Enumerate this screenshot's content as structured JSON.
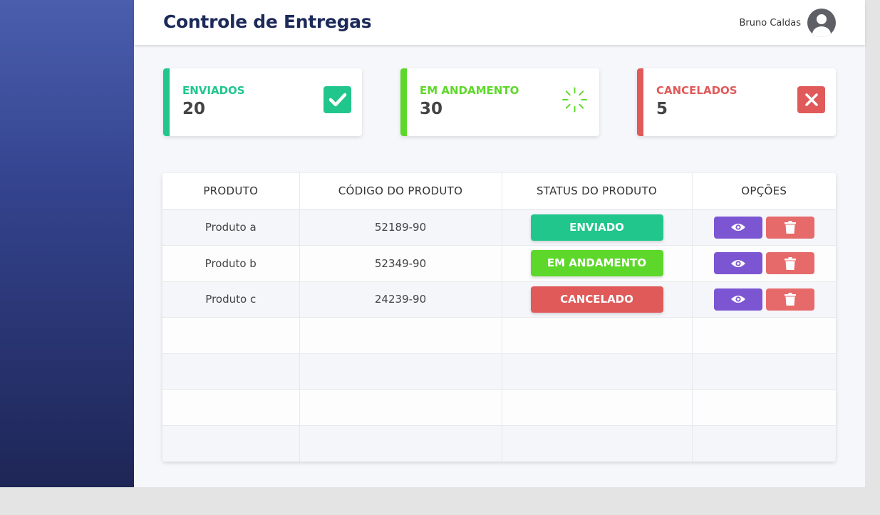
{
  "header": {
    "title": "Controle de Entregas",
    "user_name": "Bruno Caldas"
  },
  "cards": [
    {
      "label": "ENVIADOS",
      "value": "20",
      "icon": "check-icon",
      "color": "#21c68d"
    },
    {
      "label": "EM ANDAMENTO",
      "value": "30",
      "icon": "spinner-icon",
      "color": "#5dd82a"
    },
    {
      "label": "CANCELADOS",
      "value": "5",
      "icon": "x-icon",
      "color": "#e05a5a"
    }
  ],
  "table": {
    "columns": [
      "PRODUTO",
      "CÓDIGO DO PRODUTO",
      "STATUS DO PRODUTO",
      "OPÇÕES"
    ],
    "rows": [
      {
        "produto": "Produto a",
        "codigo": "52189-90",
        "status": "ENVIADO"
      },
      {
        "produto": "Produto b",
        "codigo": "52349-90",
        "status": "EM ANDAMENTO"
      },
      {
        "produto": "Produto c",
        "codigo": "24239-90",
        "status": "CANCELADO"
      }
    ]
  },
  "icons": {
    "view": "eye-icon",
    "delete": "trash-icon",
    "avatar": "user-avatar-icon"
  },
  "colors": {
    "accent_green": "#21c68d",
    "accent_lime": "#5dd82a",
    "accent_red": "#e05a5a",
    "view_purple": "#7b55d2"
  }
}
